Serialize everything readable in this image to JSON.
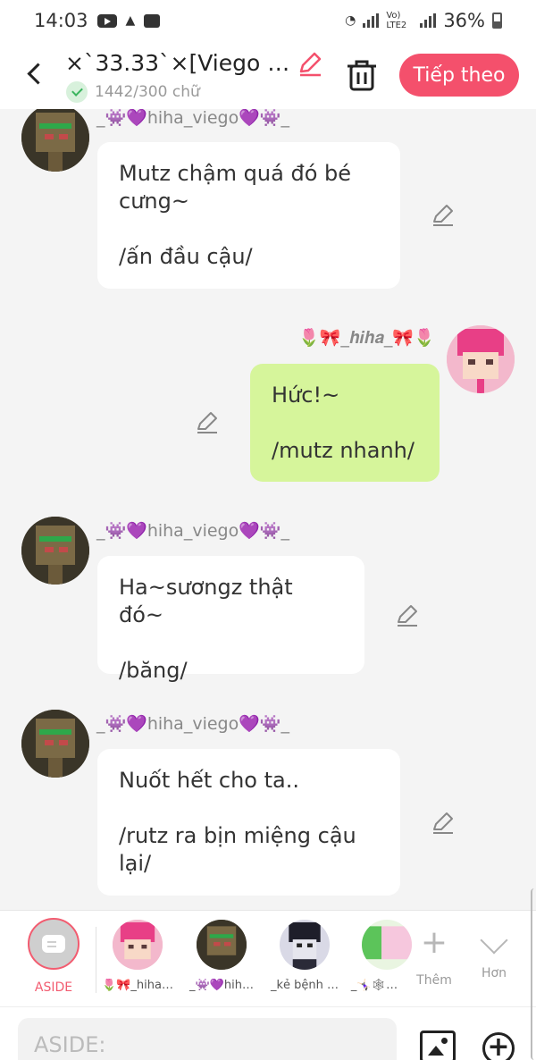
{
  "status_bar": {
    "time": "14:03",
    "network_label": "Vo) LTE2",
    "battery_percent": "36%"
  },
  "header": {
    "title": "×`33.33`×[Viego x h…",
    "word_count": "1442/300 chữ",
    "next_label": "Tiếp theo"
  },
  "messages": [
    {
      "side": "left",
      "username": "_👾💜hiha_viego💜👾_",
      "text": "Mutz chậm quá đó bé cưng~\n\n/ấn đầu cậu/"
    },
    {
      "side": "right",
      "username": "🌷🎀_𝒉𝒊𝒉𝒂_🎀🌷",
      "text": "Hức!~\n\n/mutz nhanh/"
    },
    {
      "side": "left",
      "username": "_👾💜hiha_viego💜👾_",
      "text": "Ha~sươngz thật đó~\n\n/băng/"
    },
    {
      "side": "left",
      "username": "_👾💜hiha_viego💜👾_",
      "text": "Nuốt hết cho ta..\n\n/rutz ra bịn miệng cậu lại/"
    }
  ],
  "character_bar": {
    "aside_label": "ASIDE",
    "characters": [
      {
        "name": "🌷🎀_hiha…"
      },
      {
        "name": "_👾💜hih…"
      },
      {
        "name": "_kẻ bệnh …"
      },
      {
        "name": "_🤸🏻‍♀️🕸…"
      }
    ],
    "add_label": "Thêm",
    "more_label": "Hơn"
  },
  "input": {
    "placeholder": "ASIDE:"
  },
  "colors": {
    "accent": "#f4506c",
    "right_bubble": "#d6f59b",
    "left_bubble": "#ffffff",
    "background": "#f4f4f4"
  }
}
